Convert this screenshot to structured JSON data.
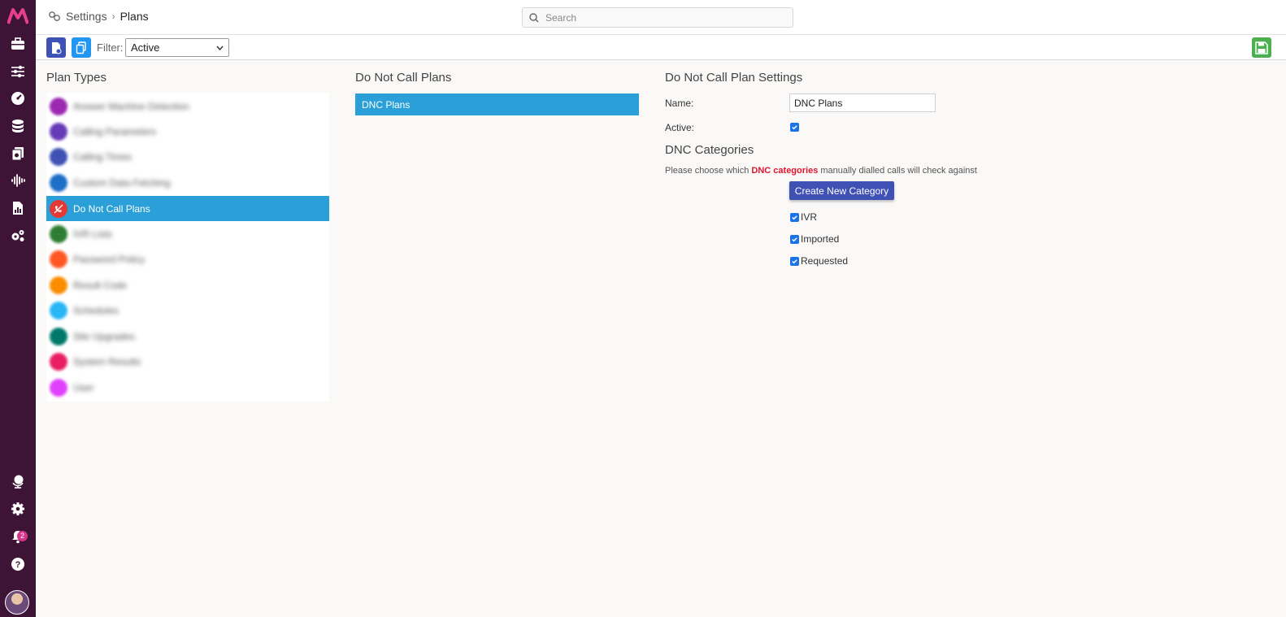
{
  "breadcrumb": {
    "root": "Settings",
    "separator": "›",
    "current": "Plans"
  },
  "search": {
    "placeholder": "Search"
  },
  "toolbar": {
    "filter_label": "Filter:",
    "filter_value": "Active"
  },
  "columns": {
    "plan_types_title": "Plan Types",
    "dnc_plans_title": "Do Not Call Plans",
    "settings_title": "Do Not Call Plan Settings"
  },
  "plan_types": [
    {
      "label": "Answer Machine Detection",
      "color": "#9c27b0",
      "blurred": true
    },
    {
      "label": "Calling Parameters",
      "color": "#673ab7",
      "blurred": true
    },
    {
      "label": "Calling Times",
      "color": "#3f51b5",
      "blurred": true
    },
    {
      "label": "Custom Data Fetching",
      "color": "#1e6fc8",
      "blurred": true
    },
    {
      "label": "Do Not Call Plans",
      "color": "#e53935",
      "blurred": false
    },
    {
      "label": "IVR Lists",
      "color": "#2e7d32",
      "blurred": true
    },
    {
      "label": "Password Policy",
      "color": "#ff5722",
      "blurred": true
    },
    {
      "label": "Result Code",
      "color": "#fb8c00",
      "blurred": true
    },
    {
      "label": "Schedules",
      "color": "#29b6f6",
      "blurred": true
    },
    {
      "label": "Site Upgrades",
      "color": "#00796b",
      "blurred": true
    },
    {
      "label": "System Results",
      "color": "#e91e63",
      "blurred": true
    },
    {
      "label": "User",
      "color": "#e040fb",
      "blurred": true
    }
  ],
  "dnc_plans": [
    {
      "label": "DNC Plans"
    }
  ],
  "settings": {
    "name_label": "Name:",
    "name_value": "DNC Plans",
    "active_label": "Active:",
    "active": true
  },
  "dnc_categories": {
    "title": "DNC Categories",
    "desc_before": "Please choose which ",
    "desc_highlight": "DNC categories",
    "desc_after": " manually dialled calls will check against",
    "create_button": "Create New Category",
    "items": [
      {
        "label": "IVR",
        "checked": true
      },
      {
        "label": "Imported",
        "checked": true
      },
      {
        "label": "Requested",
        "checked": true
      }
    ]
  },
  "notifications": {
    "count": "2"
  },
  "colors": {
    "rail": "#3d1435",
    "accent": "#2a9fd8",
    "primary": "#3f51b5",
    "save": "#4caf50",
    "highlight": "#e0152d"
  },
  "icons": [
    "logo-icon",
    "briefcase-icon",
    "sliders-icon",
    "dashboard-icon",
    "database-icon",
    "files-icon",
    "audio-wave-icon",
    "report-icon",
    "gears-icon",
    "globe-icon",
    "settings-icon",
    "bell-icon",
    "help-icon"
  ]
}
